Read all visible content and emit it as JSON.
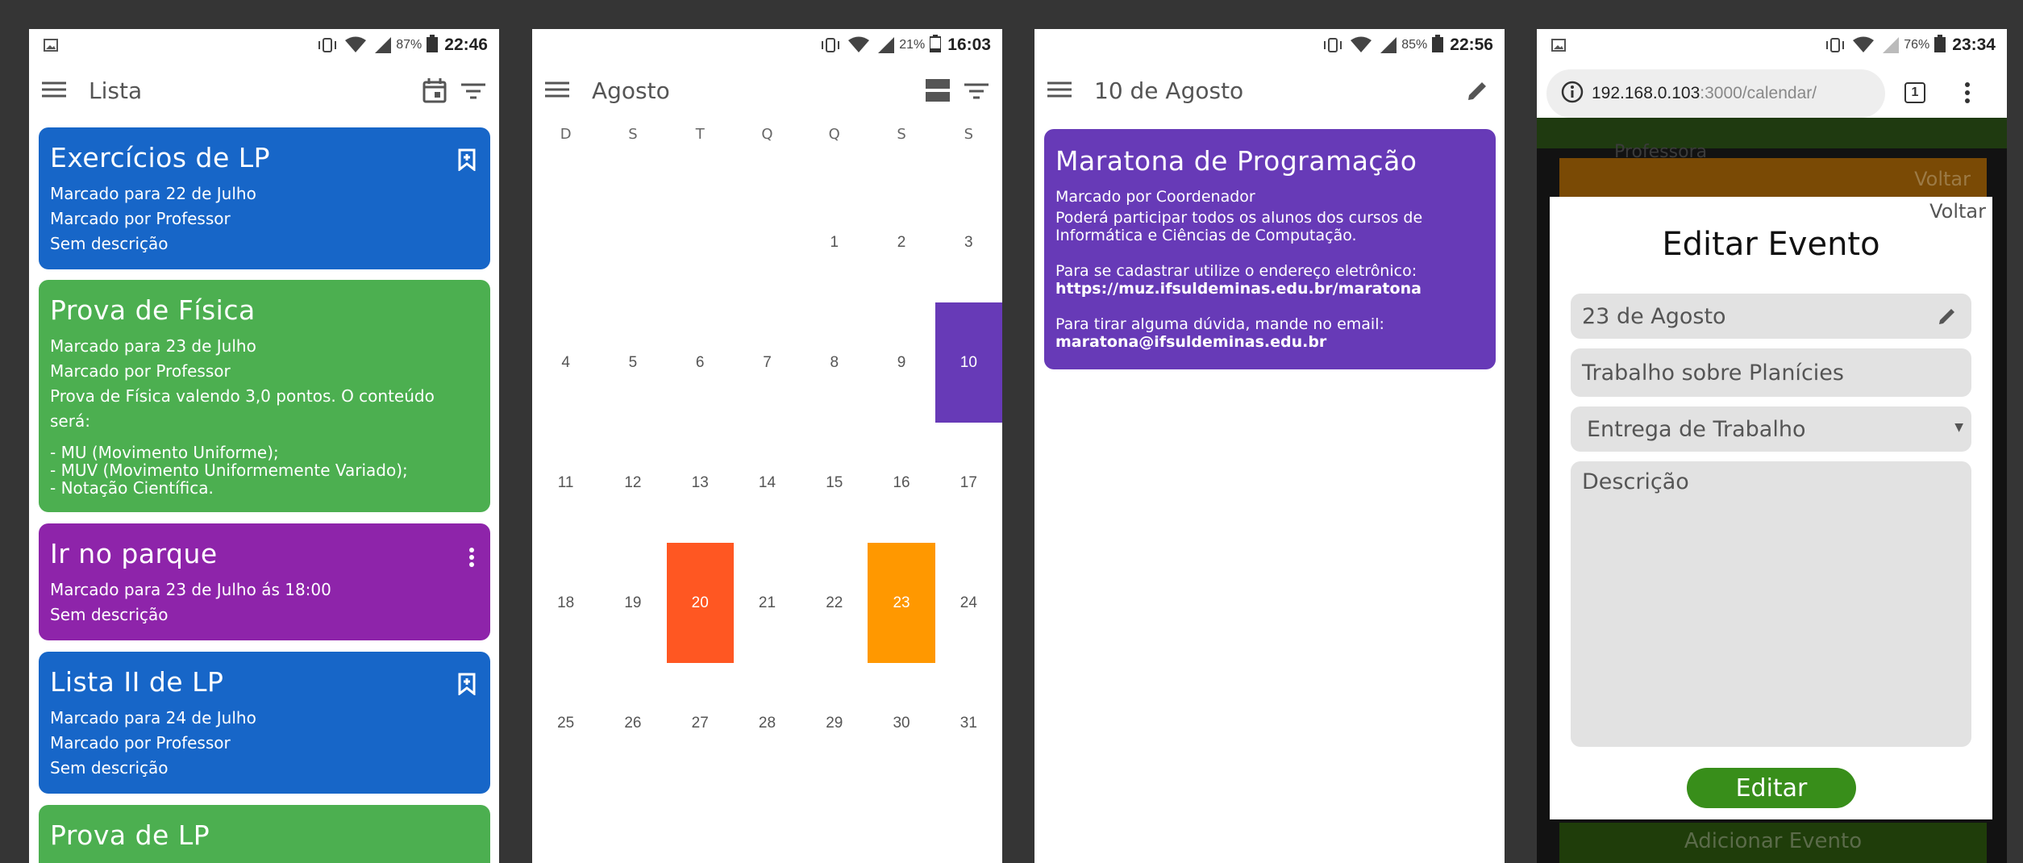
{
  "colors": {
    "blue": "#1766c8",
    "green": "#4caf50",
    "purple_card": "#8e24aa",
    "purple_event": "#673ab7",
    "orange_red": "#ff5722",
    "orange": "#ff9800",
    "background": "#353535",
    "edit_button": "#388e1a"
  },
  "screen1": {
    "status": {
      "battery": "87%",
      "time": "22:46"
    },
    "appbar": {
      "title": "Lista",
      "icons": [
        "menu-icon",
        "calendar-icon",
        "filter-icon"
      ]
    },
    "cards": [
      {
        "title": "Exercícios de LP",
        "color": "blue",
        "icon": "bookmark-add-icon",
        "lines": [
          "Marcado para 22 de Julho",
          "Marcado por Professor",
          "Sem descrição"
        ]
      },
      {
        "title": "Prova de Física",
        "color": "green",
        "icon": "",
        "lines": [
          "Marcado para 23 de Julho",
          "Marcado por Professor",
          "Prova de Física valendo 3,0 pontos. O conteúdo será:",
          "",
          "- MU (Movimento Uniforme);",
          "- MUV (Movimento Uniformemente Variado);",
          "- Notação Científica."
        ]
      },
      {
        "title": "Ir no parque",
        "color": "purple_card",
        "icon": "more-vertical-icon",
        "lines": [
          "Marcado para 23 de Julho ás 18:00",
          "Sem descrição"
        ]
      },
      {
        "title": "Lista II de LP",
        "color": "blue",
        "icon": "bookmark-add-icon",
        "lines": [
          "Marcado para 24 de Julho",
          "Marcado por Professor",
          "Sem descrição"
        ]
      },
      {
        "title": "Prova de LP",
        "color": "green",
        "icon": "",
        "lines": []
      }
    ]
  },
  "screen2": {
    "status": {
      "battery": "21%",
      "time": "16:03"
    },
    "appbar": {
      "title": "Agosto",
      "icons": [
        "menu-icon",
        "view-agenda-icon",
        "filter-icon"
      ]
    },
    "weekdays": [
      "D",
      "S",
      "T",
      "Q",
      "Q",
      "S",
      "S"
    ],
    "weeks": [
      [
        "",
        "",
        "",
        "",
        "1",
        "2",
        "3"
      ],
      [
        "4",
        "5",
        "6",
        "7",
        "8",
        "9",
        "10"
      ],
      [
        "11",
        "12",
        "13",
        "14",
        "15",
        "16",
        "17"
      ],
      [
        "18",
        "19",
        "20",
        "21",
        "22",
        "23",
        "24"
      ],
      [
        "25",
        "26",
        "27",
        "28",
        "29",
        "30",
        "31"
      ]
    ],
    "highlights": {
      "10": "purple_event",
      "20": "orange_red",
      "23": "orange"
    }
  },
  "screen3": {
    "status": {
      "battery": "85%",
      "time": "22:56"
    },
    "appbar": {
      "title": "10 de Agosto",
      "icons": [
        "menu-icon",
        "edit-icon"
      ]
    },
    "event": {
      "title": "Maratona de Programação",
      "by": "Marcado por Coordenador",
      "desc1": "Poderá participar todos os alunos dos cursos de",
      "desc2": "Informática e Ciências de Computação.",
      "signup": "Para se cadastrar utilize o endereço eletrônico:",
      "url": "https://muz.ifsuldeminas.edu.br/maratona",
      "doubt": "Para tirar alguma dúvida, mande no email:",
      "email": "maratona@ifsuldeminas.edu.br"
    }
  },
  "screen4": {
    "status": {
      "battery": "76%",
      "time": "23:34"
    },
    "browser": {
      "url_host": "192.168.0.103",
      "url_rest": ":3000/calendar/",
      "tabs_count": "1"
    },
    "behind": {
      "back_label": "Voltar",
      "add_label": "Adicionar Evento",
      "partial_text": "Professora"
    },
    "modal": {
      "back_label": "Voltar",
      "title": "Editar Evento",
      "date_value": "23 de Agosto",
      "name_value": "Trabalho sobre Planícies",
      "type_value": "Entrega de Trabalho",
      "description_placeholder": "Descrição",
      "submit_label": "Editar"
    }
  }
}
